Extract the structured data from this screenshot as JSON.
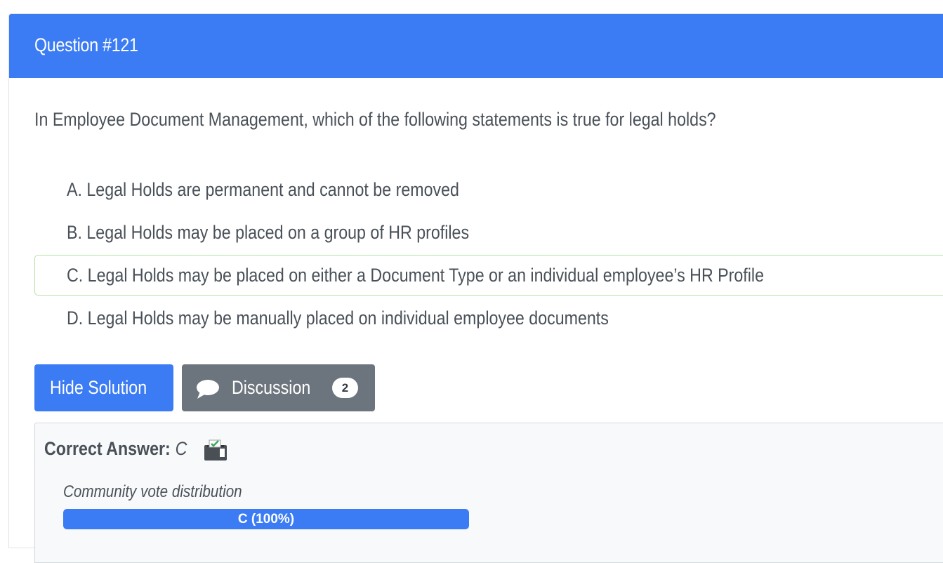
{
  "header": {
    "title": "Question #121"
  },
  "question": {
    "text": "In Employee Document Management, which of the following statements is true for legal holds?"
  },
  "choices": [
    {
      "text": "A. Legal Holds are permanent and cannot be removed",
      "correct": false
    },
    {
      "text": "B. Legal Holds may be placed on a group of HR profiles",
      "correct": false
    },
    {
      "text": "C. Legal Holds may be placed on either a Document Type or an individual employee’s HR Profile",
      "correct": true
    },
    {
      "text": "D. Legal Holds may be manually placed on individual employee documents",
      "correct": false
    }
  ],
  "buttons": {
    "hide_solution": "Hide Solution",
    "discussion": "Discussion",
    "discussion_count": "2",
    "discussion_icon": "chat-bubble-icon"
  },
  "answer": {
    "label": "Correct Answer:",
    "value": "C",
    "icon": "ballot-box-icon",
    "vote_title": "Community vote distribution",
    "votes": [
      {
        "label": "C (100%)",
        "fraction": 1.0
      }
    ]
  },
  "colors": {
    "primary": "#3b7cf4",
    "secondary": "#6c757d",
    "correct_border": "#b5e3a8"
  }
}
